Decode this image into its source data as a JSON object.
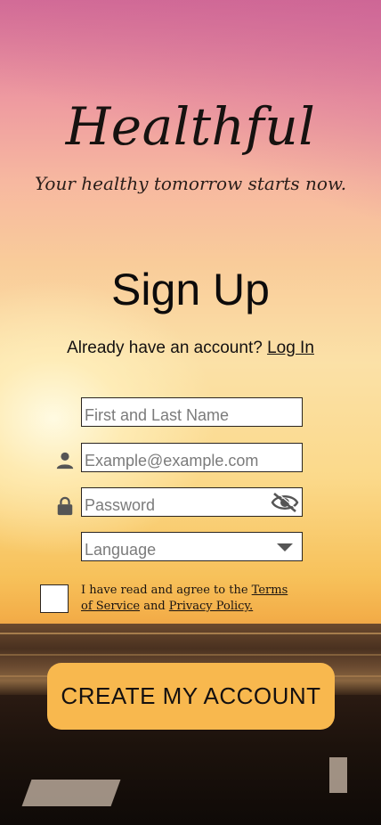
{
  "brand": {
    "name": "Healthful",
    "tagline": "Your healthy tomorrow starts now."
  },
  "signup": {
    "heading": "Sign Up",
    "already_text": "Already have an account?",
    "login_link": "Log In"
  },
  "form": {
    "name_placeholder": "First and Last Name",
    "email_placeholder": "Example@example.com",
    "password_placeholder": "Password",
    "language_placeholder": "Language"
  },
  "terms": {
    "prefix": "I have read and agree to the",
    "terms_link": "Terms of Service",
    "and_text": "and",
    "privacy_link": "Privacy Policy."
  },
  "cta": {
    "label": "CREATE MY ACCOUNT"
  },
  "colors": {
    "cta_background": "#f8b84e",
    "text": "#141010"
  },
  "icons": {
    "email": "person-icon",
    "password": "lock-icon",
    "visibility": "eye-off-icon",
    "dropdown": "chevron-down-icon"
  }
}
